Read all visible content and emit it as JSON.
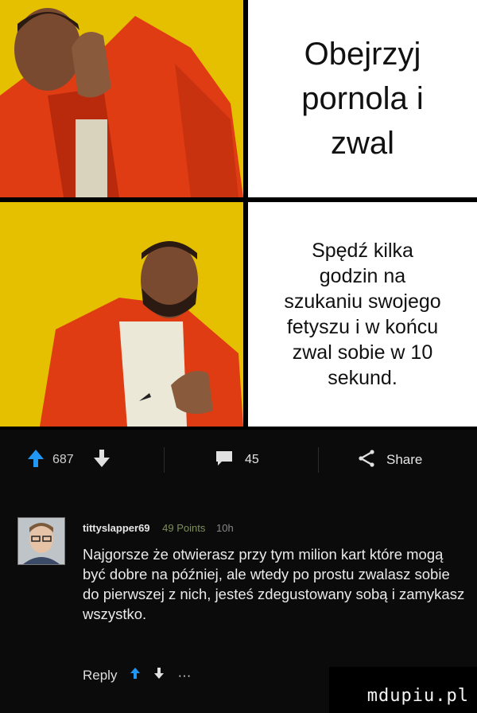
{
  "meme": {
    "top_text": [
      "Obejrzyj",
      "pornola i",
      "zwal"
    ],
    "bottom_text": [
      "Spędź kilka",
      "godzin na",
      "szukaniu swojego",
      "fetyszu i w końcu",
      "zwal sobie w 10",
      "sekund."
    ]
  },
  "actions": {
    "upvote_count": "687",
    "comment_count": "45",
    "share_label": "Share"
  },
  "comment": {
    "username": "tittyslapper69",
    "points": "49 Points",
    "time": "10h",
    "body": "Najgorsze że otwierasz przy tym milion kart które mogą być dobre na później, ale wtedy po prostu zwalasz sobie do pierwszej z nich, jesteś zdegustowany sobą i zamykasz wszystko.",
    "reply_label": "Reply",
    "more_label": "···"
  },
  "watermark": "mdupiu.pl",
  "colors": {
    "accent_blue": "#2196f3",
    "panel_yellow": "#e8c400",
    "jacket_red": "#e23a12"
  }
}
